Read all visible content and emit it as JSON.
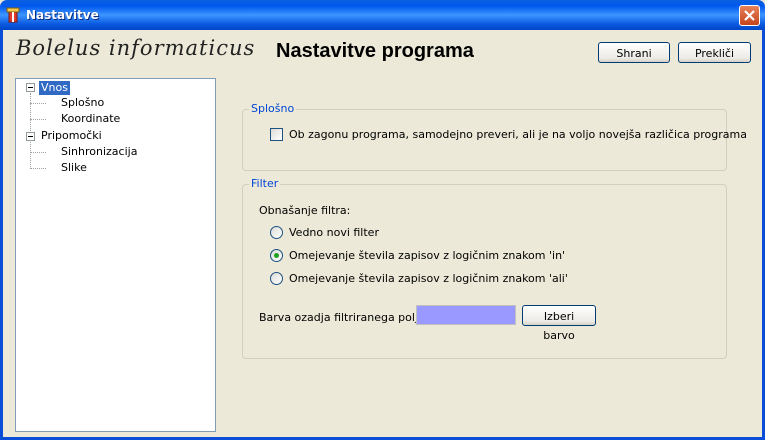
{
  "window": {
    "title": "Nastavitve",
    "close_icon": "close-icon",
    "app_icon": "app-icon"
  },
  "header": {
    "brand": "Bolelus informaticus",
    "title": "Nastavitve programa",
    "save_label": "Shrani",
    "cancel_label": "Prekliči"
  },
  "tree": {
    "items": [
      {
        "label": "Vnos",
        "level": 0,
        "expanded": true,
        "selected": true
      },
      {
        "label": "Splošno",
        "level": 1
      },
      {
        "label": "Koordinate",
        "level": 1
      },
      {
        "label": "Pripomočki",
        "level": 0,
        "expanded": true
      },
      {
        "label": "Sinhronizacija",
        "level": 1
      },
      {
        "label": "Slike",
        "level": 1
      }
    ]
  },
  "general": {
    "legend": "Splošno",
    "check_update_label": "Ob zagonu programa, samodejno preveri, ali je na voljo novejša različica programa",
    "check_update_checked": false
  },
  "filter": {
    "legend": "Filter",
    "behavior_label": "Obnašanje filtra:",
    "options": [
      {
        "label": "Vedno novi filter",
        "selected": false
      },
      {
        "label": "Omejevanje števila zapisov z logičnim znakom 'in'",
        "selected": true
      },
      {
        "label": "Omejevanje števila zapisov z logičnim znakom 'ali'",
        "selected": false
      }
    ],
    "bg_color_label": "Barva ozadja filtriranega polja:",
    "bg_color": "#9999ff",
    "choose_color_label": "Izberi barvo"
  },
  "colors": {
    "titlebar": "#0058ee",
    "selection": "#316ac5",
    "groupbox_legend": "#0046d5",
    "radio_dot": "#21a121"
  }
}
